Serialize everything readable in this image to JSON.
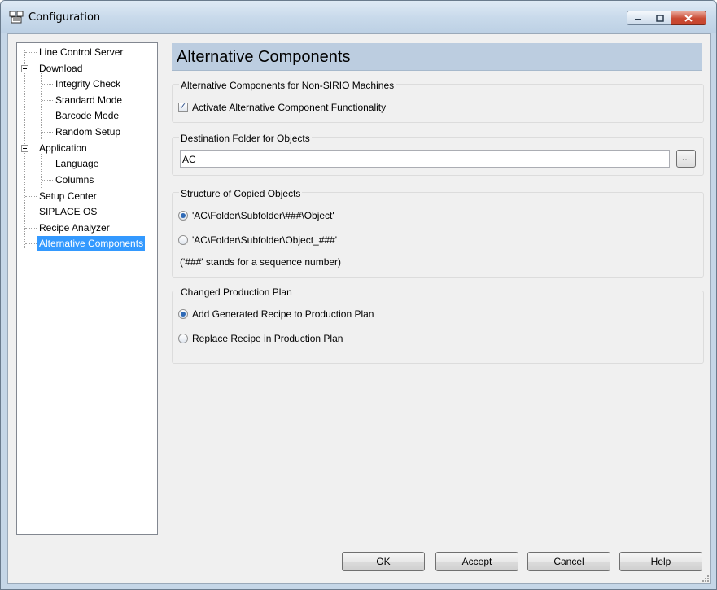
{
  "window": {
    "title": "Configuration",
    "controls": {
      "minimize": "minimize-icon",
      "maximize": "maximize-icon",
      "close": "close-icon"
    }
  },
  "tree": {
    "items": [
      {
        "label": "Line Control Server",
        "level": 0
      },
      {
        "label": "Download",
        "level": 0,
        "expanded": true
      },
      {
        "label": "Integrity Check",
        "level": 1
      },
      {
        "label": "Standard Mode",
        "level": 1
      },
      {
        "label": "Barcode Mode",
        "level": 1
      },
      {
        "label": "Random Setup",
        "level": 1
      },
      {
        "label": "Application",
        "level": 0,
        "expanded": true
      },
      {
        "label": "Language",
        "level": 1
      },
      {
        "label": "Columns",
        "level": 1
      },
      {
        "label": "Setup Center",
        "level": 0
      },
      {
        "label": "SIPLACE OS",
        "level": 0
      },
      {
        "label": "Recipe Analyzer",
        "level": 0
      },
      {
        "label": "Alternative Components",
        "level": 0,
        "selected": true
      }
    ]
  },
  "panel": {
    "title": "Alternative Components",
    "non_sirio": {
      "label": "Alternative Components for Non-SIRIO Machines",
      "activate_label": "Activate Alternative Component Functionality",
      "activate_checked": true
    },
    "destination": {
      "label": "Destination Folder for Objects",
      "value": "AC",
      "browse_label": "..."
    },
    "structure": {
      "label": "Structure of Copied Objects",
      "option1": "'AC\\Folder\\Subfolder\\###\\Object'",
      "option2": "'AC\\Folder\\Subfolder\\Object_###'",
      "selected": 1,
      "note": "('###' stands for a sequence number)"
    },
    "plan": {
      "label": "Changed Production Plan",
      "option1": "Add Generated Recipe to Production Plan",
      "option2": "Replace Recipe in Production Plan",
      "selected": 1
    }
  },
  "buttons": {
    "ok": "OK",
    "accept": "Accept",
    "cancel": "Cancel",
    "help": "Help"
  },
  "colors": {
    "selection": "#3399ff",
    "header": "#bccde0",
    "close_button": "#c94a33"
  }
}
